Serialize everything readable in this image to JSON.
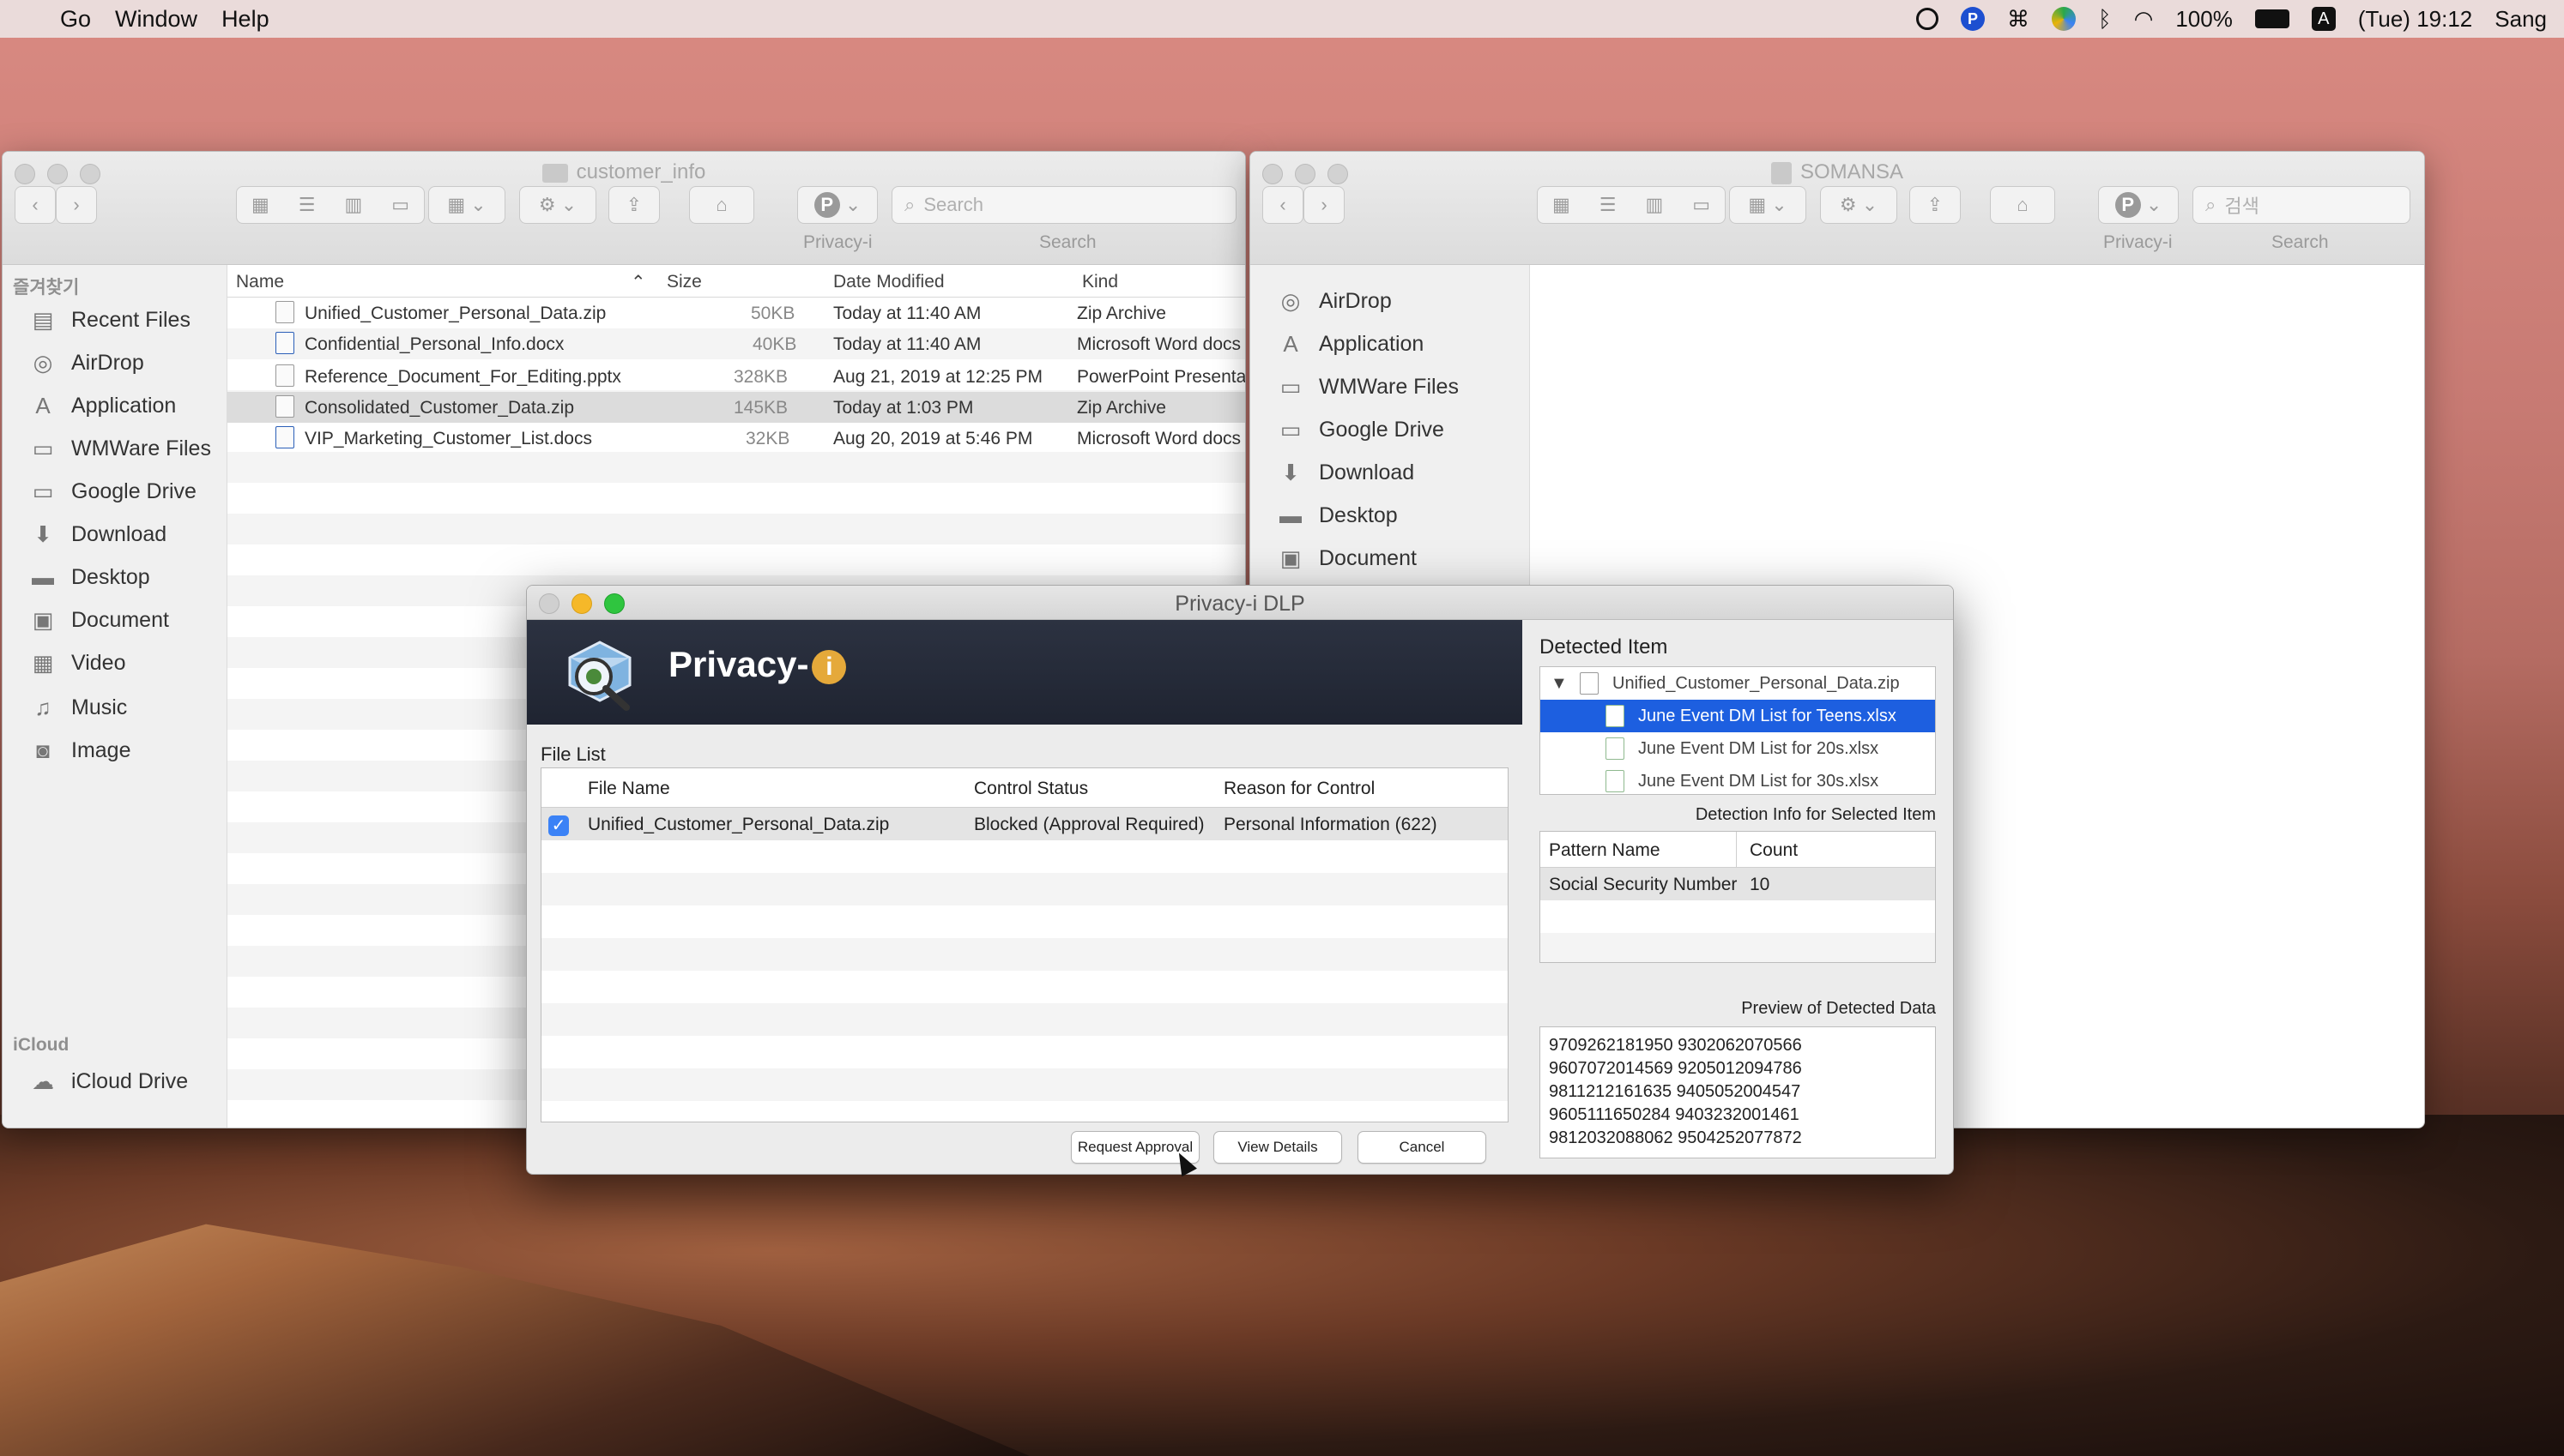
{
  "menubar": {
    "items": [
      "Go",
      "Window",
      "Help"
    ],
    "battery": "100%",
    "clock": "(Tue) 19:12",
    "user": "Sang",
    "input_label": "A"
  },
  "finder_left": {
    "title": "customer_info",
    "toolbar_labels": {
      "privacy": "Privacy-i",
      "search": "Search"
    },
    "search_placeholder": "Search",
    "sidebar_section_favorites": "즐겨찾기",
    "sidebar_items": [
      "Recent Files",
      "AirDrop",
      "Application",
      "WMWare Files",
      "Google Drive",
      "Download",
      "Desktop",
      "Document",
      "Video",
      "Music",
      "Image"
    ],
    "sidebar_section_icloud": "iCloud",
    "icloud_item": "iCloud Drive",
    "columns": {
      "name": "Name",
      "size": "Size",
      "date": "Date Modified",
      "kind": "Kind"
    },
    "files": [
      {
        "name": "Unified_Customer_Personal_Data.zip",
        "size": "50KB",
        "date": "Today at 11:40 AM",
        "kind": "Zip Archive"
      },
      {
        "name": "Confidential_Personal_Info.docx",
        "size": "40KB",
        "date": "Today at 11:40 AM",
        "kind": "Microsoft Word docs"
      },
      {
        "name": "Reference_Document_For_Editing.pptx",
        "size": "328KB",
        "date": "Aug 21, 2019 at 12:25 PM",
        "kind": "PowerPoint Presenta"
      },
      {
        "name": "Consolidated_Customer_Data.zip",
        "size": "145KB",
        "date": "Today at 1:03 PM",
        "kind": "Zip Archive"
      },
      {
        "name": "VIP_Marketing_Customer_List.docs",
        "size": "32KB",
        "date": "Aug 20, 2019 at 5:46 PM",
        "kind": "Microsoft Word docs"
      }
    ]
  },
  "finder_right": {
    "title": "SOMANSA",
    "toolbar_labels": {
      "privacy": "Privacy-i",
      "search": "Search"
    },
    "search_placeholder": "검색",
    "sidebar_items": [
      "AirDrop",
      "Application",
      "WMWare Files",
      "Google Drive",
      "Download",
      "Desktop",
      "Document"
    ]
  },
  "dialog": {
    "title": "Privacy-i DLP",
    "brand": "Privacy-",
    "brand_badge": "i",
    "file_list_label": "File List",
    "columns": {
      "file_name": "File Name",
      "status": "Control Status",
      "reason": "Reason for Control"
    },
    "rows": [
      {
        "file_name": "Unified_Customer_Personal_Data.zip",
        "status": "Blocked (Approval Required)",
        "reason": "Personal Information (622)"
      }
    ],
    "detected_item_label": "Detected Item",
    "tree": {
      "root": "Unified_Customer_Personal_Data.zip",
      "children": [
        "June Event DM List for Teens.xlsx",
        "June Event DM List for 20s.xlsx",
        "June Event DM List for 30s.xlsx"
      ]
    },
    "detection_info_label": "Detection Info for Selected Item",
    "detection_columns": {
      "pattern": "Pattern Name",
      "count": "Count"
    },
    "detections": [
      {
        "pattern": "Social Security Number",
        "count": "10"
      }
    ],
    "preview_label": "Preview of Detected Data",
    "preview_lines": [
      "9709262181950 9302062070566",
      "9607072014569 9205012094786",
      "9811212161635 9405052004547",
      "9605111650284 9403232001461",
      "9812032088062 9504252077872"
    ],
    "buttons": {
      "request": "Request Approval",
      "details": "View Details",
      "cancel": "Cancel"
    }
  }
}
